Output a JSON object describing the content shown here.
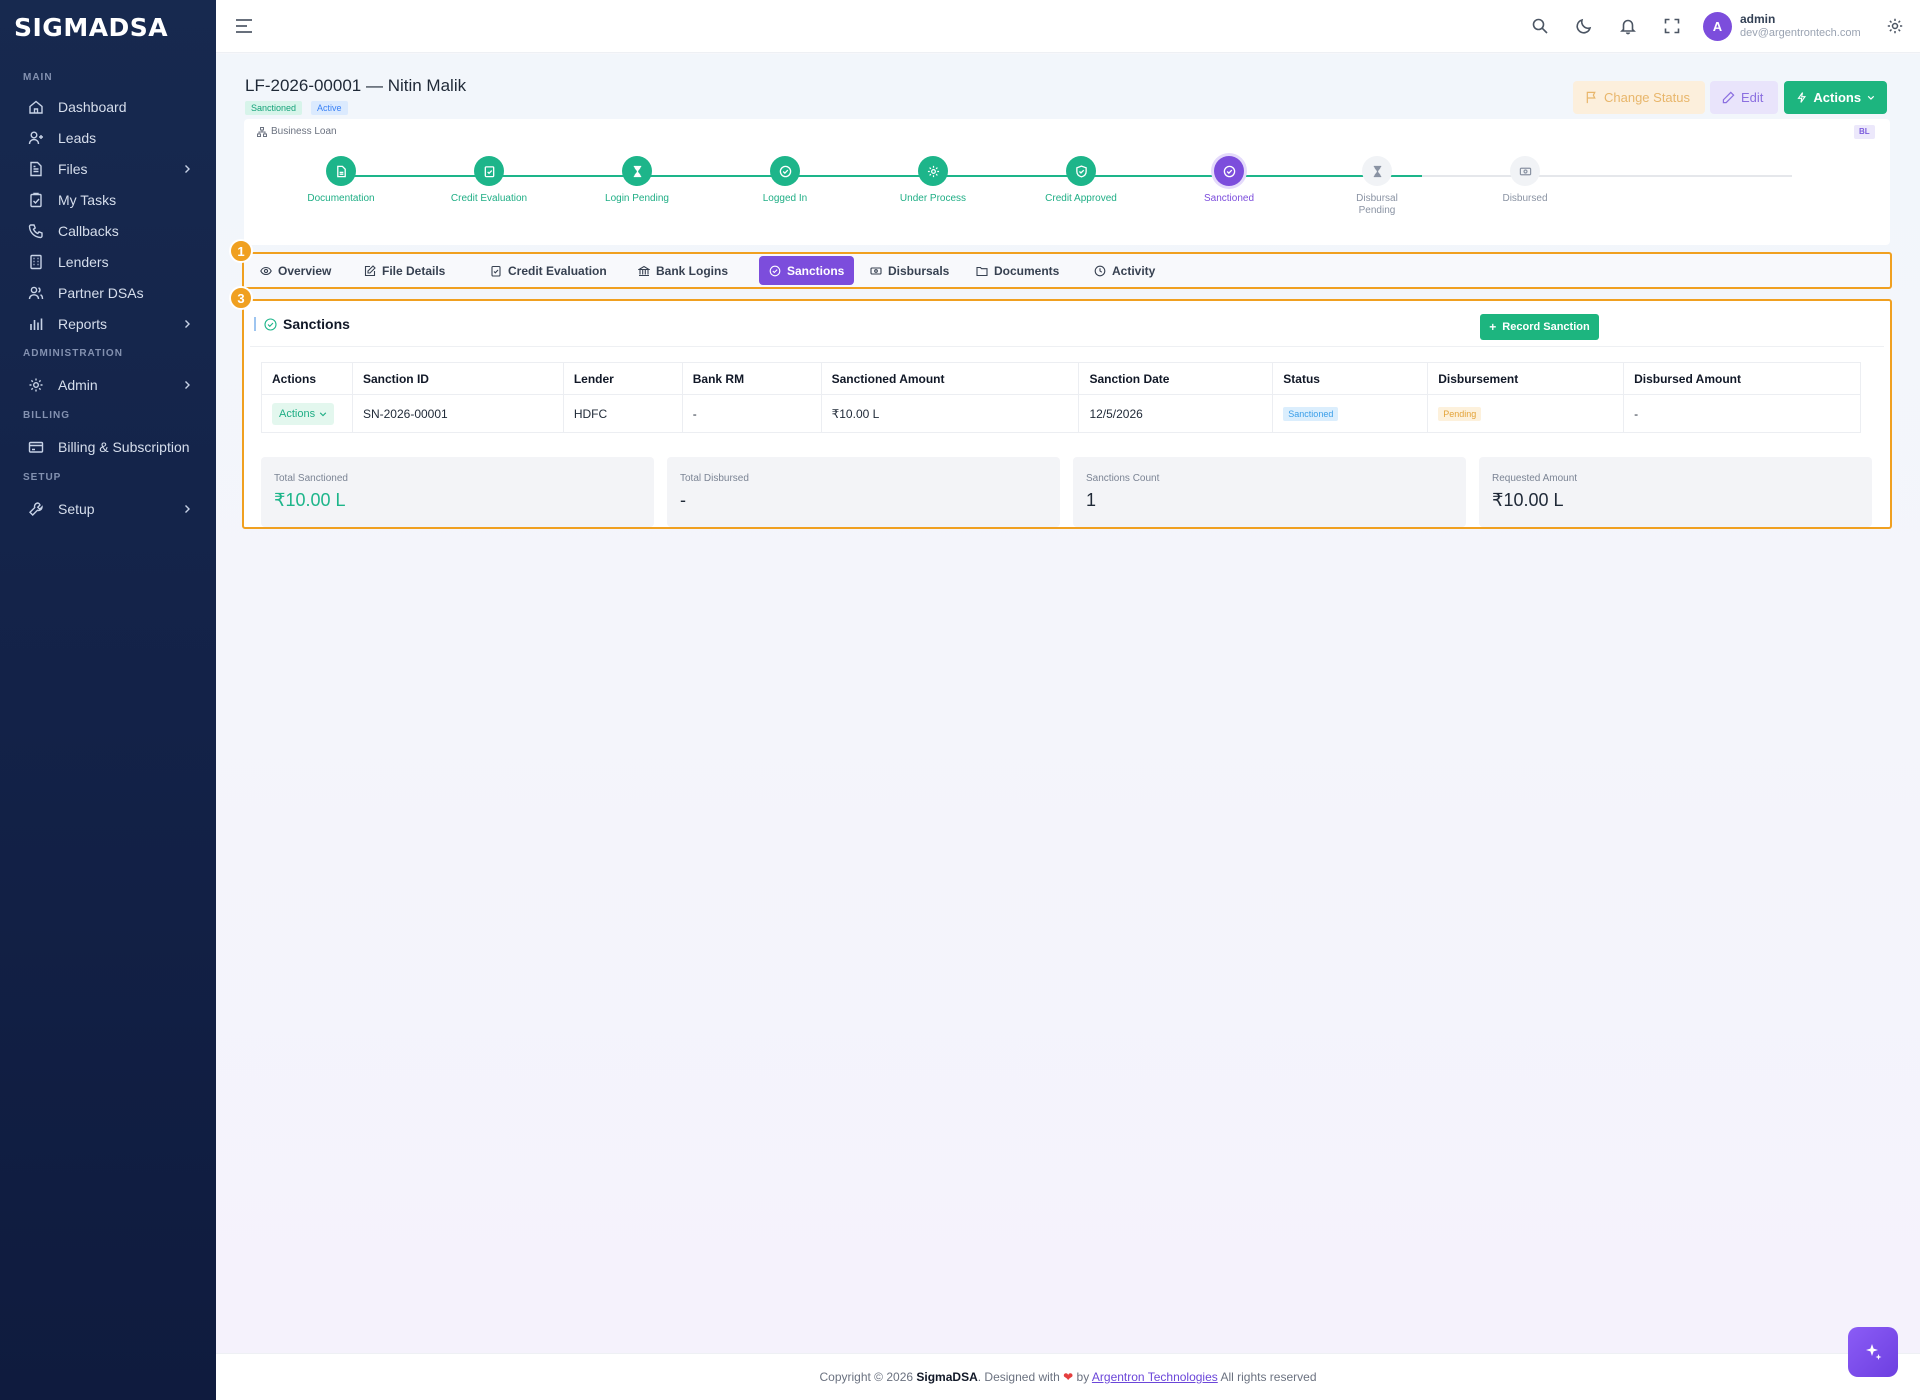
{
  "sidebar": {
    "logo": "SIGMADSA",
    "sections": {
      "main": "MAIN",
      "administration": "ADMINISTRATION",
      "billing": "BILLING",
      "setup": "SETUP"
    },
    "items": {
      "dashboard": "Dashboard",
      "leads": "Leads",
      "files": "Files",
      "my_tasks": "My Tasks",
      "callbacks": "Callbacks",
      "lenders": "Lenders",
      "partner_dsas": "Partner DSAs",
      "reports": "Reports",
      "admin": "Admin",
      "billing_subscription": "Billing & Subscription",
      "setup": "Setup"
    }
  },
  "topbar": {
    "avatar_letter": "A",
    "user_name": "admin",
    "user_email": "dev@argentrontech.com",
    "icons": [
      "menu-icon",
      "search-icon",
      "moon-icon",
      "bell-icon",
      "fullscreen-icon",
      "gear-icon"
    ]
  },
  "file": {
    "title": "LF-2026-00001 — Nitin Malik",
    "status_badge": "Sanctioned",
    "active_badge": "Active",
    "loan_type": "Business Loan",
    "loan_code": "BL"
  },
  "header_buttons": {
    "change_status": "Change Status",
    "edit": "Edit",
    "actions": "Actions"
  },
  "pipeline": {
    "steps": [
      {
        "label": "Documentation",
        "state": "done"
      },
      {
        "label": "Credit Evaluation",
        "state": "done"
      },
      {
        "label": "Login Pending",
        "state": "done"
      },
      {
        "label": "Logged In",
        "state": "done"
      },
      {
        "label": "Under Process",
        "state": "done"
      },
      {
        "label": "Credit Approved",
        "state": "done"
      },
      {
        "label": "Sanctioned",
        "state": "current"
      },
      {
        "label": "Disbursal Pending",
        "state": "todo"
      },
      {
        "label": "Disbursed",
        "state": "todo"
      }
    ]
  },
  "markers": {
    "tabs": "1",
    "content": "3"
  },
  "tabs": [
    {
      "label": "Overview"
    },
    {
      "label": "File Details"
    },
    {
      "label": "Credit Evaluation"
    },
    {
      "label": "Bank Logins"
    },
    {
      "label": "Sanctions",
      "active": true
    },
    {
      "label": "Disbursals"
    },
    {
      "label": "Documents"
    },
    {
      "label": "Activity"
    }
  ],
  "sanctions": {
    "title": "Sanctions",
    "record_button": "Record Sanction",
    "columns": [
      "Actions",
      "Sanction ID",
      "Lender",
      "Bank RM",
      "Sanctioned Amount",
      "Sanction Date",
      "Status",
      "Disbursement",
      "Disbursed Amount"
    ],
    "rows": [
      {
        "actions": "Actions",
        "sanction_id": "SN-2026-00001",
        "lender": "HDFC",
        "bank_rm": "-",
        "sanctioned_amount": "₹10.00 L",
        "sanction_date": "12/5/2026",
        "status": "Sanctioned",
        "disbursement": "Pending",
        "disbursed_amount": "-"
      }
    ],
    "stats": [
      {
        "label": "Total Sanctioned",
        "value": "₹10.00 L"
      },
      {
        "label": "Total Disbursed",
        "value": "-"
      },
      {
        "label": "Sanctions Count",
        "value": "1"
      },
      {
        "label": "Requested Amount",
        "value": "₹10.00 L"
      }
    ]
  },
  "footer": {
    "prefix": "Copyright © 2026",
    "brand": "SigmaDSA",
    "designed": ". Designed with",
    "by": "by",
    "company": "Argentron Technologies",
    "suffix": "All rights reserved"
  },
  "colors": {
    "accent_purple": "#7c4ddc",
    "accent_green": "#1db57f",
    "highlight_orange": "#f0a020",
    "sidebar_bg": "#132248"
  }
}
